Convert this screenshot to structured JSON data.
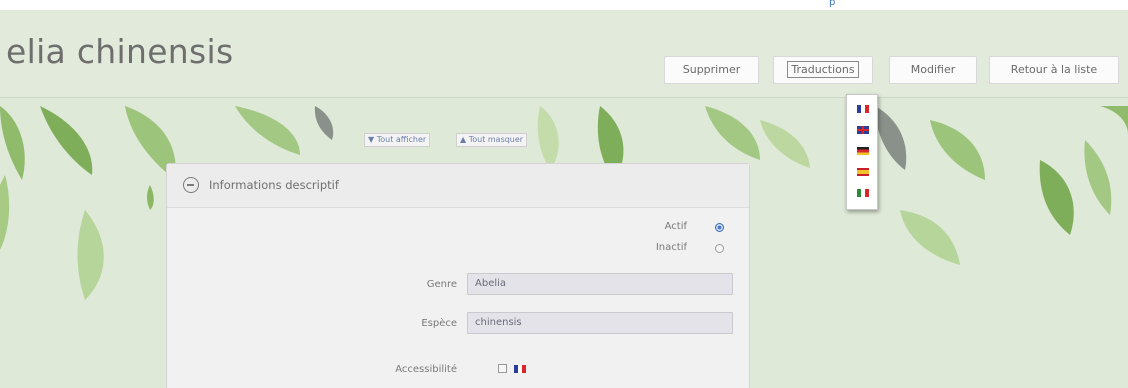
{
  "page": {
    "title": "elia chinensis"
  },
  "toolbar": {
    "delete_label": "Supprimer",
    "translations_label": "Traductions",
    "edit_label": "Modifier",
    "back_label": "Retour à la liste"
  },
  "translations_menu": {
    "languages": [
      "fr",
      "en",
      "de",
      "es",
      "it"
    ]
  },
  "toggles": {
    "show_all": "▼ Tout afficher",
    "hide_all": "▲ Tout masquer"
  },
  "panel": {
    "title": "Informations descriptif",
    "status": {
      "active_label": "Actif",
      "inactive_label": "Inactif",
      "selected": "Actif"
    },
    "genre": {
      "label": "Genre",
      "value": "Abelia"
    },
    "espece": {
      "label": "Espèce",
      "value": "chinensis"
    },
    "accessibilite": {
      "label": "Accessibilité"
    }
  },
  "colors": {
    "background": "#dfe9d8",
    "leaf_green": "#8cb864",
    "leaf_dark": "#8a918a",
    "link": "#3a78c2",
    "radio_checked": "#4a7ac8"
  }
}
